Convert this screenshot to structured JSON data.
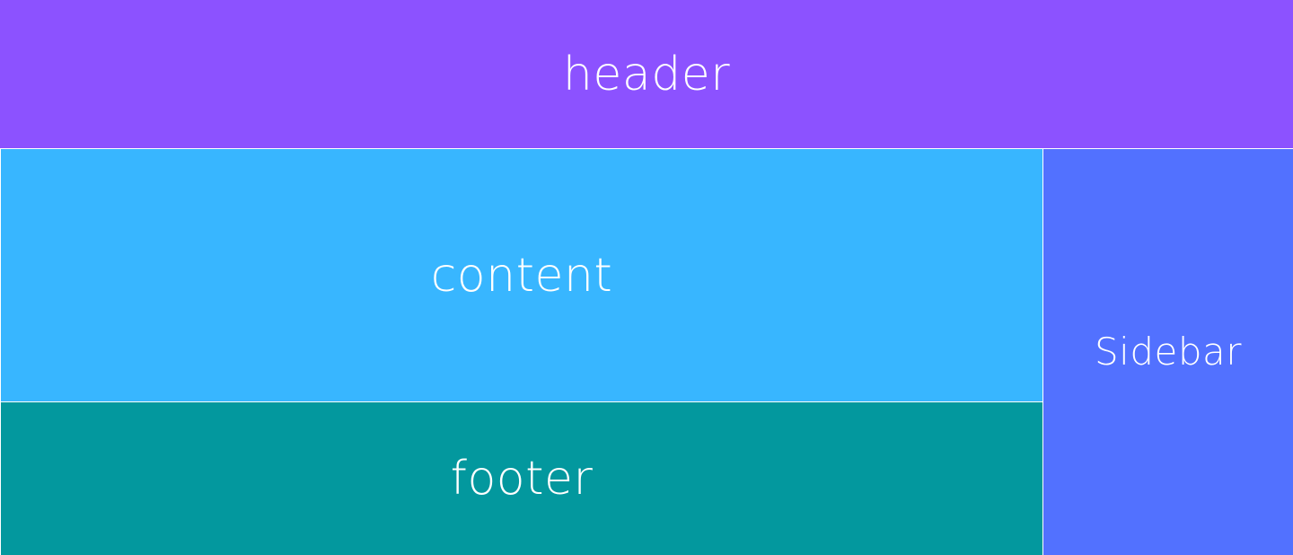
{
  "colors": {
    "header": "#8C52FF",
    "content": "#38B6FF",
    "footer": "#03989E",
    "sidebar": "#5271FF",
    "text": "#FFFFFF"
  },
  "layout": {
    "header": {
      "label": "header"
    },
    "content": {
      "label": "content"
    },
    "footer": {
      "label": "footer"
    },
    "sidebar": {
      "label": "Sidebar"
    }
  }
}
